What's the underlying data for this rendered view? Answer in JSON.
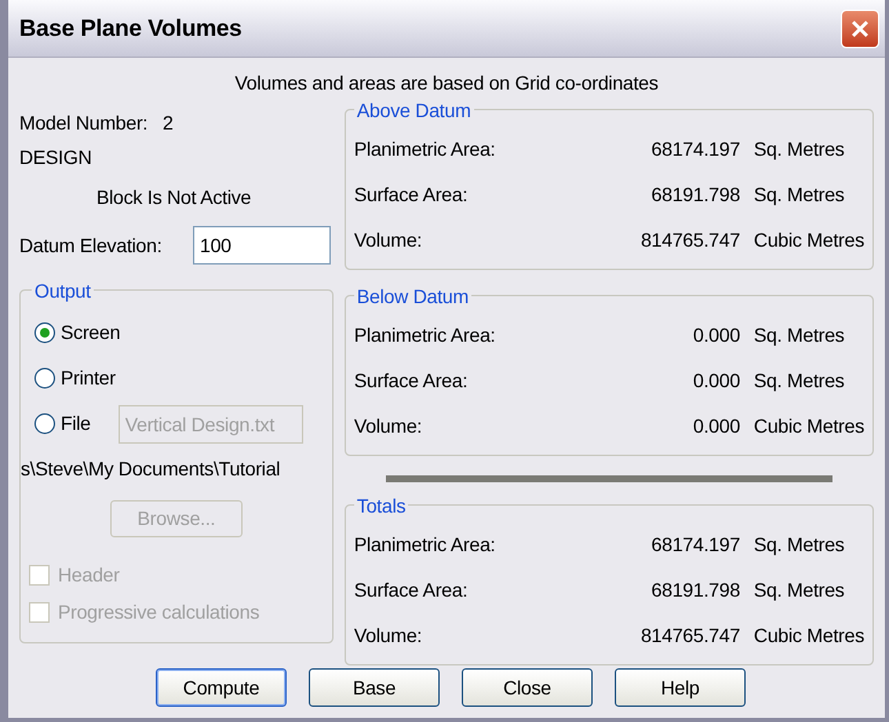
{
  "window": {
    "title": "Base Plane Volumes"
  },
  "note": "Volumes and areas are based on Grid co-ordinates",
  "model": {
    "label": "Model Number:",
    "value": "2",
    "name": "DESIGN",
    "block_status": "Block Is Not Active"
  },
  "datum_elevation": {
    "label": "Datum Elevation:",
    "value": "100"
  },
  "output": {
    "title": "Output",
    "options": [
      {
        "label": "Screen",
        "selected": true
      },
      {
        "label": "Printer",
        "selected": false
      },
      {
        "label": "File",
        "selected": false
      }
    ],
    "file_field": {
      "value": "Vertical Design.txt",
      "disabled": true
    },
    "path": "s\\Steve\\My Documents\\Tutorial",
    "browse_button": {
      "label": "Browse...",
      "disabled": true
    },
    "checkboxes": [
      {
        "label": "Header",
        "checked": false,
        "disabled": true
      },
      {
        "label": "Progressive calculations",
        "checked": false,
        "disabled": true
      }
    ]
  },
  "groups": [
    {
      "title": "Above Datum",
      "rows": [
        {
          "label": "Planimetric Area:",
          "value": "68174.197",
          "unit": "Sq. Metres"
        },
        {
          "label": "Surface Area:",
          "value": "68191.798",
          "unit": "Sq. Metres"
        },
        {
          "label": "Volume:",
          "value": "814765.747",
          "unit": "Cubic Metres"
        }
      ]
    },
    {
      "title": "Below Datum",
      "rows": [
        {
          "label": "Planimetric Area:",
          "value": "0.000",
          "unit": "Sq. Metres"
        },
        {
          "label": "Surface Area:",
          "value": "0.000",
          "unit": "Sq. Metres"
        },
        {
          "label": "Volume:",
          "value": "0.000",
          "unit": "Cubic Metres"
        }
      ]
    },
    {
      "title": "Totals",
      "rows": [
        {
          "label": "Planimetric Area:",
          "value": "68174.197",
          "unit": "Sq. Metres"
        },
        {
          "label": "Surface Area:",
          "value": "68191.798",
          "unit": "Sq. Metres"
        },
        {
          "label": "Volume:",
          "value": "814765.747",
          "unit": "Cubic Metres"
        }
      ]
    }
  ],
  "buttons": [
    {
      "label": "Compute",
      "default": true
    },
    {
      "label": "Base",
      "default": false
    },
    {
      "label": "Close",
      "default": false
    },
    {
      "label": "Help",
      "default": false
    }
  ]
}
